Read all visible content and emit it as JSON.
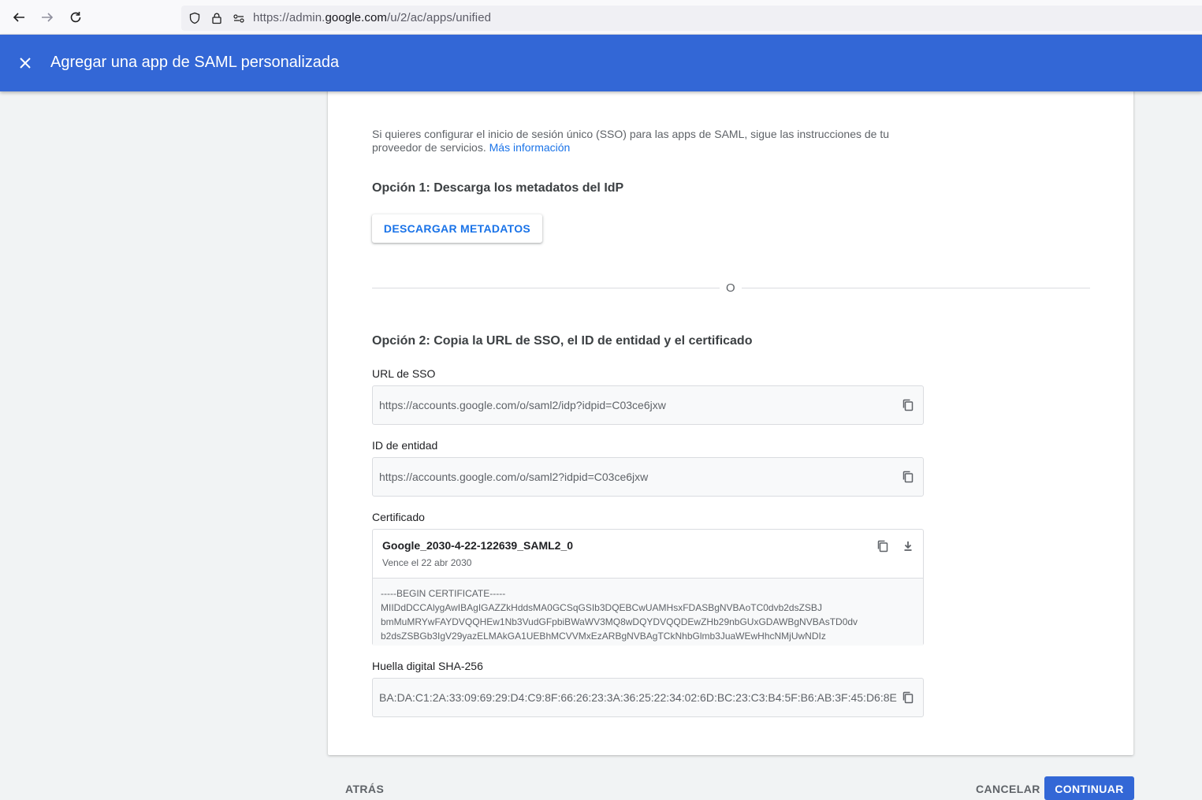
{
  "browser": {
    "url_prefix": "https://admin.",
    "url_domain": "google.com",
    "url_path": "/u/2/ac/apps/unified"
  },
  "header": {
    "title": "Agregar una app de SAML personalizada"
  },
  "intro": {
    "text": "Si quieres configurar el inicio de sesión único (SSO) para las apps de SAML, sigue las instrucciones de tu proveedor de servicios.",
    "link": "Más información"
  },
  "option1": {
    "title": "Opción 1: Descarga los metadatos del IdP",
    "button": "DESCARGAR METADATOS"
  },
  "divider": {
    "label": "O"
  },
  "option2": {
    "title": "Opción 2: Copia la URL de SSO, el ID de entidad y el certificado",
    "sso_url": {
      "label": "URL de SSO",
      "value": "https://accounts.google.com/o/saml2/idp?idpid=C03ce6jxw"
    },
    "entity_id": {
      "label": "ID de entidad",
      "value": "https://accounts.google.com/o/saml2?idpid=C03ce6jxw"
    },
    "certificate": {
      "label": "Certificado",
      "name": "Google_2030-4-22-122639_SAML2_0",
      "expires": "Vence el 22 abr 2030",
      "lines": [
        "-----BEGIN CERTIFICATE-----",
        "MIIDdDCCAlygAwIBAgIGAZZkHddsMA0GCSqGSIb3DQEBCwUAMHsxFDASBgNVBAoTC0dvb2dsZSBJ",
        "bmMuMRYwFAYDVQQHEw1Nb3VudGFpbiBWaWV3MQ8wDQYDVQQDEwZHb29nbGUxGDAWBgNVBAsTD0dv",
        "b2dsZSBGb3IgV29yazELMAkGA1UEBhMCVVMxEzARBgNVBAgTCkNhbGlmb3JuaWEwHhcNMjUwNDIz"
      ]
    },
    "fingerprint": {
      "label": "Huella digital SHA-256",
      "value": "BA:DA:C1:2A:33:09:69:29:D4:C9:8F:66:26:23:3A:36:25:22:34:02:6D:BC:23:C3:B4:5F:B6:AB:3F:45:D6:8E"
    }
  },
  "footer": {
    "back": "ATRÁS",
    "cancel": "CANCELAR",
    "continue": "CONTINUAR"
  },
  "colors": {
    "header_bg": "#3367d6",
    "link": "#1a73e8"
  },
  "icons": {
    "back": "arrow-left-icon",
    "forward": "arrow-right-icon",
    "reload": "reload-icon",
    "shield": "shield-icon",
    "lock": "lock-icon",
    "permissions": "permissions-icon",
    "close": "close-icon",
    "copy": "copy-icon",
    "download": "download-icon"
  }
}
